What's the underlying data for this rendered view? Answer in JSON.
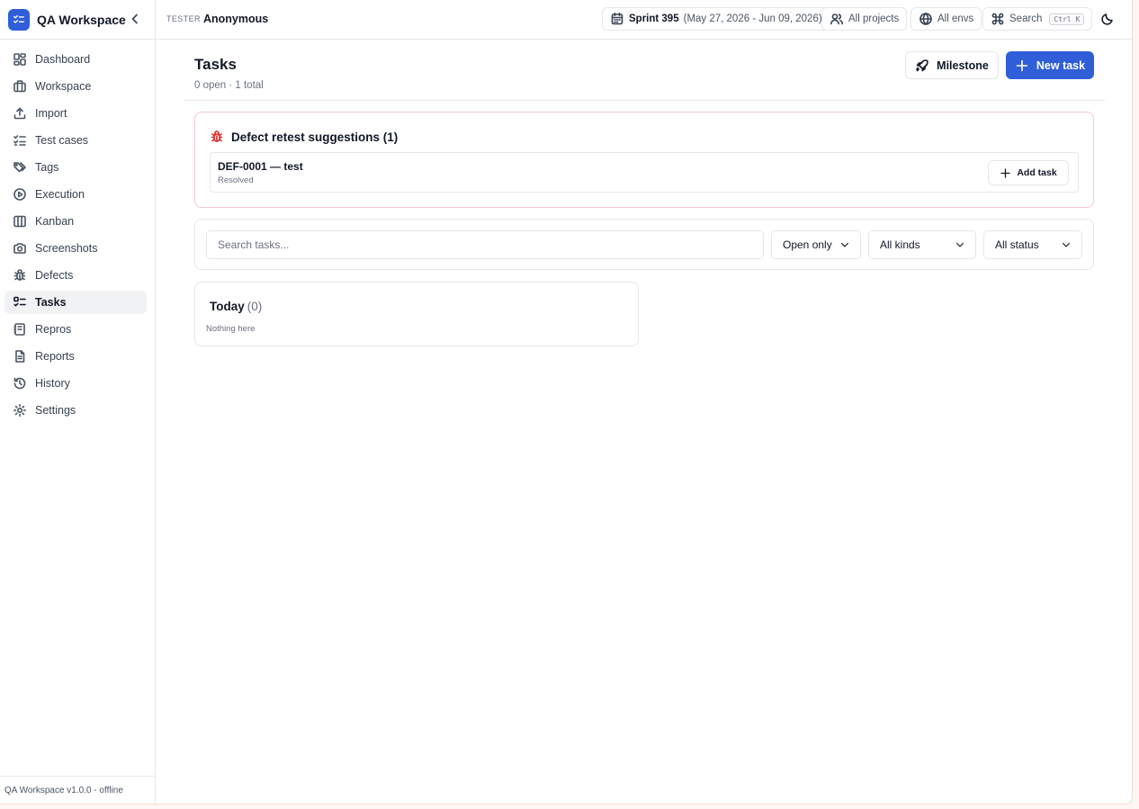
{
  "app": {
    "name": "QA Workspace",
    "footer": "QA Workspace v1.0.0 - offline"
  },
  "sidebar": {
    "items": [
      {
        "label": "Dashboard",
        "icon": "dashboard-icon"
      },
      {
        "label": "Workspace",
        "icon": "briefcase-icon"
      },
      {
        "label": "Import",
        "icon": "upload-icon"
      },
      {
        "label": "Test cases",
        "icon": "checklist-icon"
      },
      {
        "label": "Tags",
        "icon": "tags-icon"
      },
      {
        "label": "Execution",
        "icon": "play-circle-icon"
      },
      {
        "label": "Kanban",
        "icon": "columns-icon"
      },
      {
        "label": "Screenshots",
        "icon": "camera-icon"
      },
      {
        "label": "Defects",
        "icon": "bug-icon"
      },
      {
        "label": "Tasks",
        "icon": "task-list-icon",
        "active": true
      },
      {
        "label": "Repros",
        "icon": "notebook-icon"
      },
      {
        "label": "Reports",
        "icon": "report-icon"
      },
      {
        "label": "History",
        "icon": "history-icon"
      },
      {
        "label": "Settings",
        "icon": "gear-icon"
      }
    ]
  },
  "topbar": {
    "user_role": "TESTER",
    "user_name": "Anonymous",
    "sprint_name": "Sprint 395",
    "sprint_range": "(May 27, 2026 - Jun 09, 2026)",
    "projects_label": "All projects",
    "envs_label": "All envs",
    "search_label": "Search",
    "search_shortcut": "Ctrl K"
  },
  "page": {
    "title": "Tasks",
    "subtitle": "0 open · 1 total",
    "milestone_label": "Milestone",
    "new_task_label": "New task"
  },
  "suggestions": {
    "title": "Defect retest suggestions (1)",
    "items": [
      {
        "name": "DEF-0001 — test",
        "status": "Resolved",
        "action": "Add task"
      }
    ]
  },
  "filters": {
    "search_placeholder": "Search tasks...",
    "scope": "Open only",
    "kind": "All kinds",
    "status": "All status"
  },
  "groups": [
    {
      "title": "Today",
      "count": "(0)",
      "empty_text": "Nothing here"
    }
  ],
  "colors": {
    "accent": "#2f5ed8",
    "defect_red": "#dc2626",
    "suggestion_border": "#f7c7cf"
  }
}
